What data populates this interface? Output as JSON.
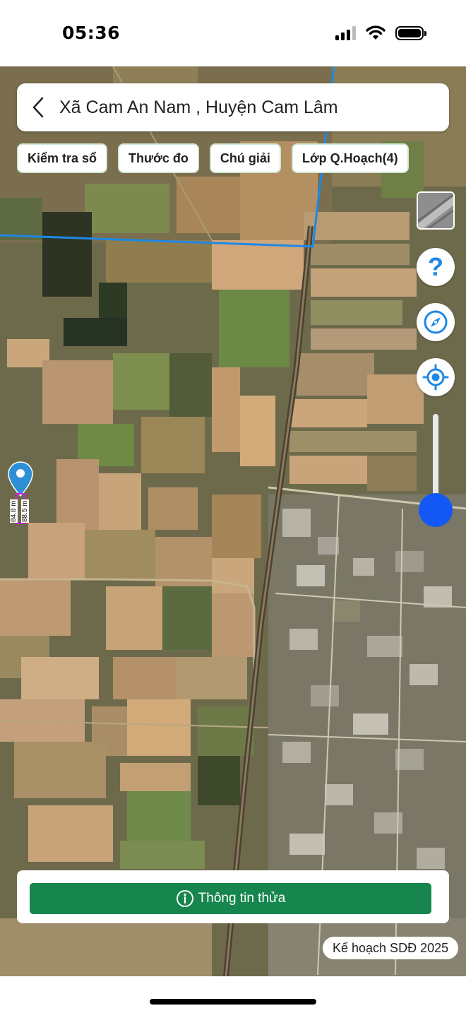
{
  "status_bar": {
    "time": "05:36"
  },
  "header": {
    "title": "Xã Cam An Nam , Huyện Cam Lâm"
  },
  "chips": [
    {
      "label": "Kiểm tra sổ"
    },
    {
      "label": "Thước đo"
    },
    {
      "label": "Chú giải"
    },
    {
      "label": "Lớp Q.Hoạch(4)"
    }
  ],
  "map": {
    "help_symbol": "?",
    "boundary_color": "#1e88e5",
    "accent_color": "#1358f5",
    "measurements": [
      "84.8 m",
      "88.5 m"
    ],
    "zoom_level": 0.15
  },
  "info_card": {
    "button_label": "Thông tin thửa",
    "button_color": "#17864e"
  },
  "plan_badge": {
    "label": "Kế hoạch SDĐ 2025"
  },
  "icons": [
    "back-chevron-icon",
    "satellite-layer-icon",
    "help-icon",
    "compass-icon",
    "locate-icon",
    "map-pin-icon",
    "info-icon",
    "signal-icon",
    "wifi-icon",
    "battery-icon"
  ]
}
